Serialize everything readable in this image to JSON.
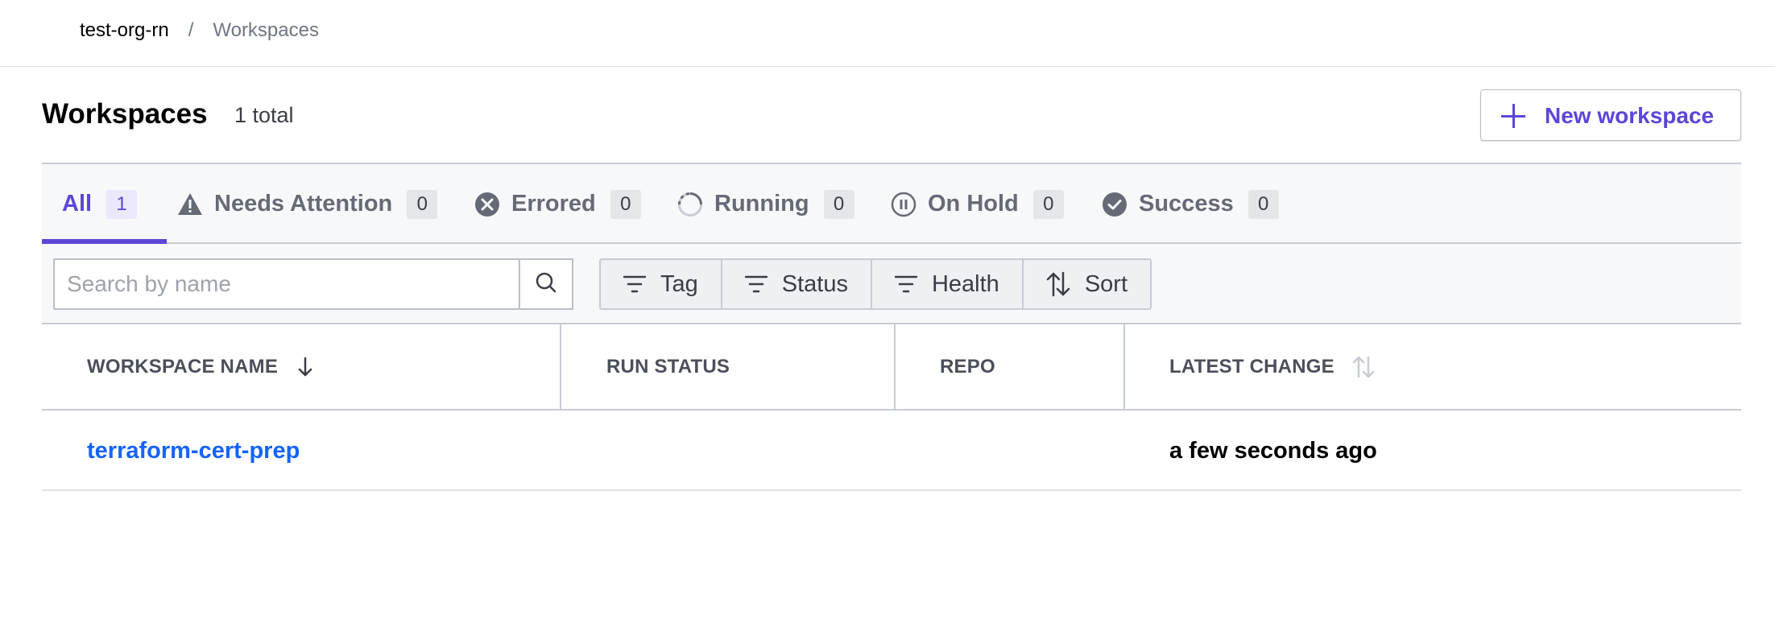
{
  "breadcrumb": {
    "org": "test-org-rn",
    "separator": "/",
    "current": "Workspaces"
  },
  "header": {
    "title": "Workspaces",
    "total": "1 total",
    "new_button_label": "New workspace"
  },
  "tabs": [
    {
      "label": "All",
      "count": "1",
      "icon": "none",
      "active": true
    },
    {
      "label": "Needs Attention",
      "count": "0",
      "icon": "warning-icon"
    },
    {
      "label": "Errored",
      "count": "0",
      "icon": "error-icon"
    },
    {
      "label": "Running",
      "count": "0",
      "icon": "running-icon"
    },
    {
      "label": "On Hold",
      "count": "0",
      "icon": "pause-icon"
    },
    {
      "label": "Success",
      "count": "0",
      "icon": "check-icon"
    }
  ],
  "toolbar": {
    "search_placeholder": "Search by name",
    "filters": [
      {
        "label": "Tag",
        "icon": "filter-icon"
      },
      {
        "label": "Status",
        "icon": "filter-icon"
      },
      {
        "label": "Health",
        "icon": "filter-icon"
      },
      {
        "label": "Sort",
        "icon": "sort-icon"
      }
    ]
  },
  "table": {
    "columns": [
      "WORKSPACE NAME",
      "RUN STATUS",
      "REPO",
      "LATEST CHANGE"
    ],
    "rows": [
      {
        "name": "terraform-cert-prep",
        "run_status": "",
        "repo": "",
        "latest_change": "a few seconds ago"
      }
    ]
  },
  "colors": {
    "accent": "#5e45d8",
    "link": "#1563ff",
    "muted": "#656a76"
  }
}
